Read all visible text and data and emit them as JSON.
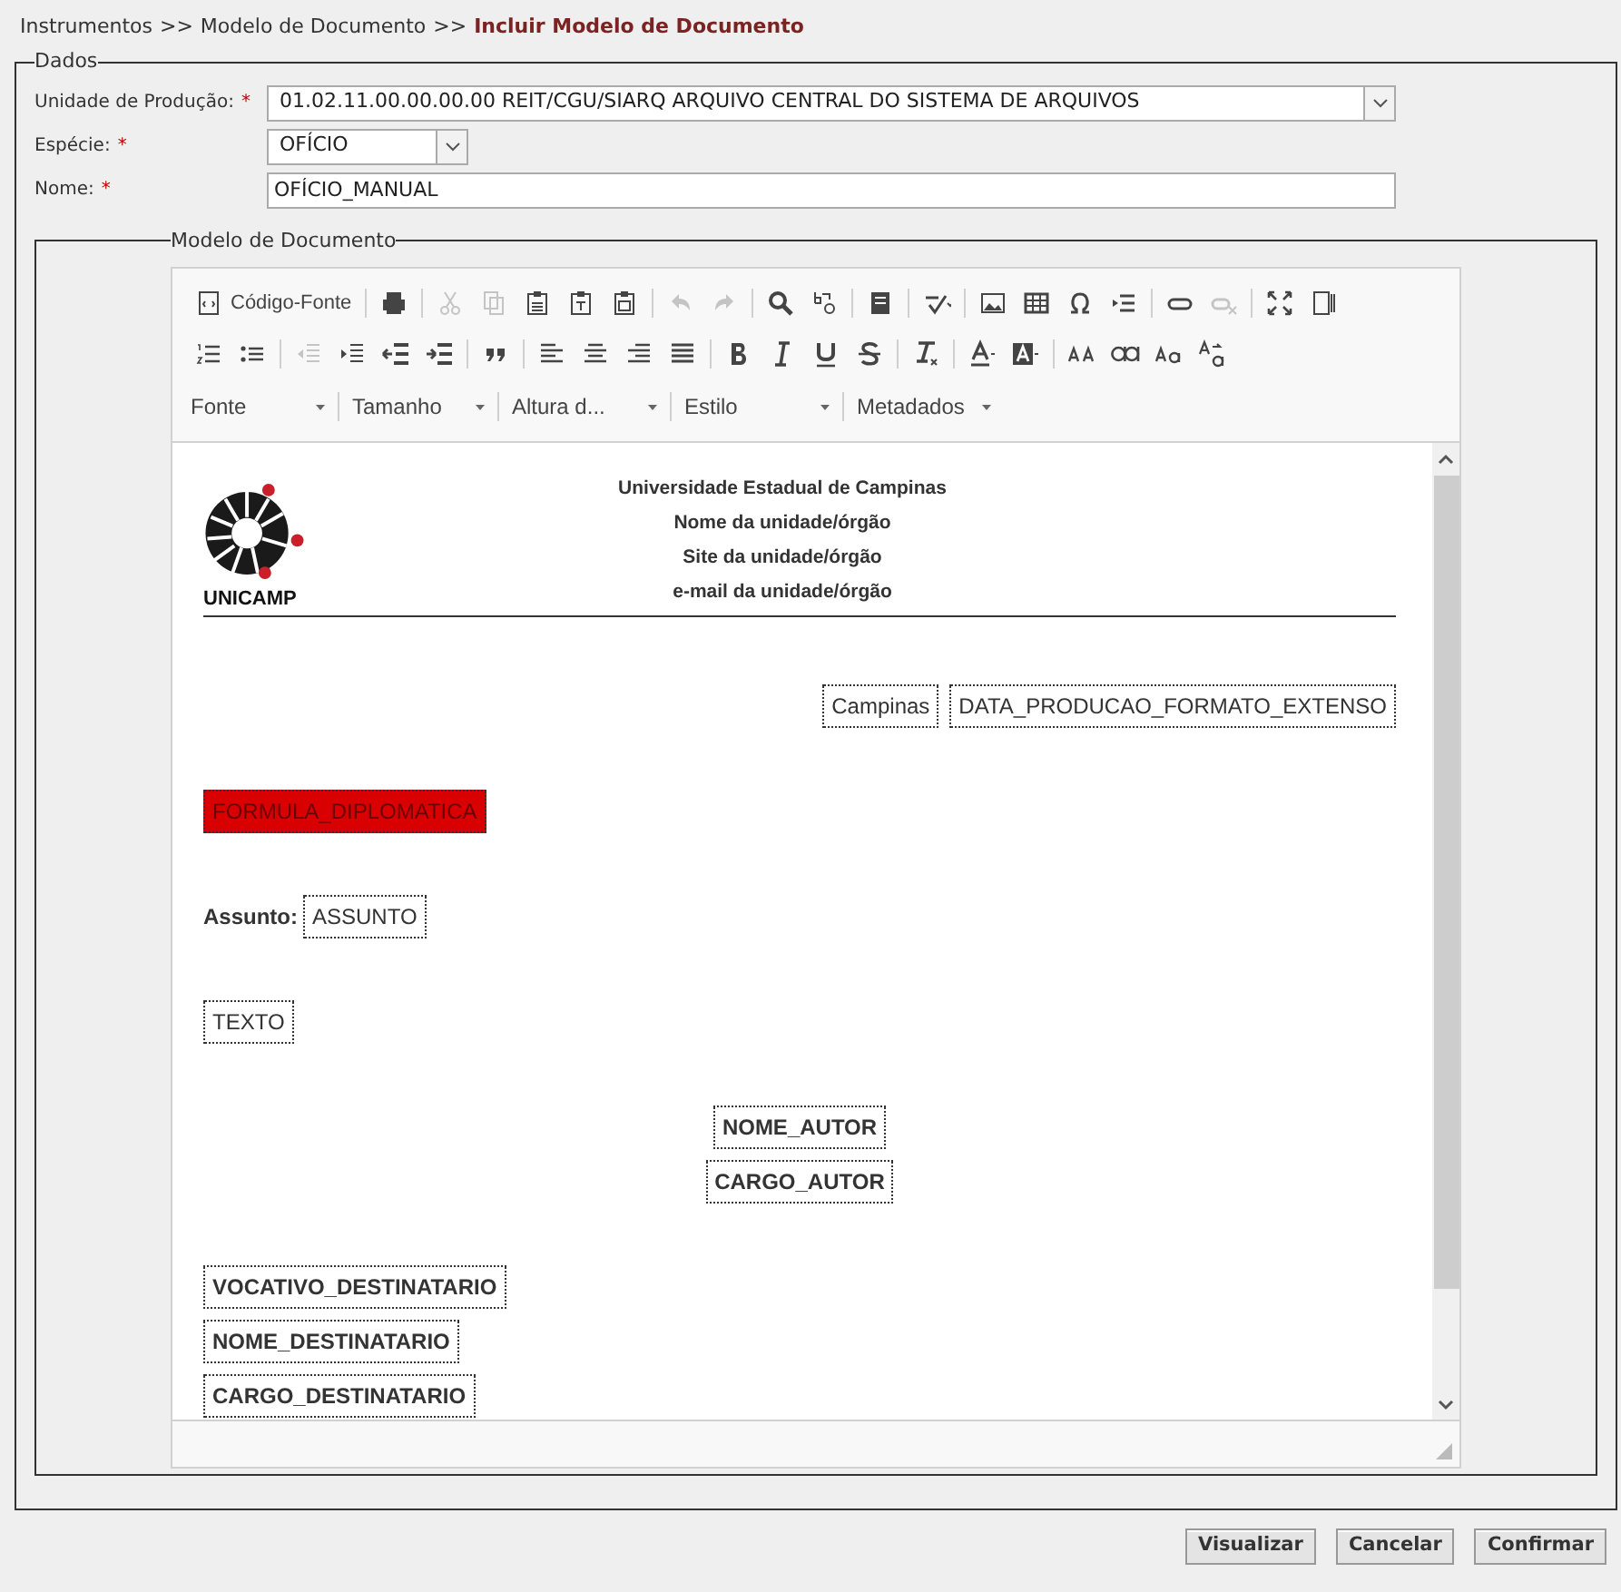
{
  "breadcrumb": [
    {
      "kind": "link",
      "text": "Instrumentos"
    },
    {
      "kind": "separator",
      "text": ">>"
    },
    {
      "kind": "link",
      "text": "Modelo de Documento"
    },
    {
      "kind": "separator",
      "text": ">>"
    },
    {
      "kind": "current",
      "text": "Incluir Modelo de Documento"
    }
  ],
  "dados": {
    "legend": "Dados",
    "fields": [
      {
        "kind": "select",
        "label": "Unidade de Produção:",
        "required": "*",
        "value": "01.02.11.00.00.00.00 REIT/CGU/SIARQ ARQUIVO CENTRAL DO SISTEMA DE ARQUIVOS"
      },
      {
        "kind": "choice",
        "label": "Espécie:",
        "required": "*",
        "value": "OFÍCIO"
      },
      {
        "kind": "input",
        "label": "Nome:",
        "required": "*",
        "value": "OFÍCIO_MANUAL"
      }
    ]
  },
  "modelo": {
    "legend": "Modelo de Documento",
    "toolbar": [
      [
        [
          {
            "kind": "source",
            "label": "Código-Fonte",
            "disabled": false
          }
        ],
        [
          {
            "kind": "print",
            "disabled": false
          }
        ],
        [
          {
            "kind": "cut",
            "disabled": true
          },
          {
            "kind": "copy",
            "disabled": true
          },
          {
            "kind": "paste",
            "disabled": false
          },
          {
            "kind": "pastetext",
            "disabled": false
          },
          {
            "kind": "pasteword",
            "disabled": false
          }
        ],
        [
          {
            "kind": "undo",
            "disabled": true
          },
          {
            "kind": "redo",
            "disabled": true
          }
        ],
        [
          {
            "kind": "find",
            "disabled": false
          },
          {
            "kind": "replace",
            "disabled": false
          }
        ],
        [
          {
            "kind": "template",
            "disabled": false
          }
        ],
        [
          {
            "kind": "spell",
            "disabled": false
          }
        ],
        [
          {
            "kind": "image",
            "disabled": false
          },
          {
            "kind": "table",
            "disabled": false
          },
          {
            "kind": "omega",
            "disabled": false
          },
          {
            "kind": "pagebreak",
            "disabled": false
          }
        ],
        [
          {
            "kind": "link",
            "disabled": false
          },
          {
            "kind": "unlink",
            "disabled": true
          }
        ],
        [
          {
            "kind": "maximize",
            "disabled": false
          },
          {
            "kind": "blocks",
            "disabled": false
          }
        ]
      ],
      [
        [
          {
            "kind": "numlist",
            "disabled": false
          },
          {
            "kind": "bullist",
            "disabled": false
          }
        ],
        [
          {
            "kind": "outdent",
            "disabled": true
          },
          {
            "kind": "indent",
            "disabled": false
          },
          {
            "kind": "outdentbold",
            "disabled": false
          },
          {
            "kind": "indentbold",
            "disabled": false
          }
        ],
        [
          {
            "kind": "quote",
            "disabled": false
          }
        ],
        [
          {
            "kind": "alignleft",
            "disabled": false
          },
          {
            "kind": "aligncenter",
            "disabled": false
          },
          {
            "kind": "alignright",
            "disabled": false
          },
          {
            "kind": "justify",
            "disabled": false
          }
        ],
        [
          {
            "kind": "bold",
            "disabled": false
          },
          {
            "kind": "italic",
            "disabled": false
          },
          {
            "kind": "underline",
            "disabled": false
          },
          {
            "kind": "strike",
            "disabled": false
          }
        ],
        [
          {
            "kind": "removeformat",
            "disabled": false
          }
        ],
        [
          {
            "kind": "textcolor",
            "disabled": false
          },
          {
            "kind": "bgcolor",
            "disabled": false
          }
        ],
        [
          {
            "kind": "upper",
            "disabled": false
          },
          {
            "kind": "lower",
            "disabled": false
          },
          {
            "kind": "capital",
            "disabled": false
          },
          {
            "kind": "toggle",
            "disabled": false
          }
        ]
      ]
    ],
    "dropdowns": [
      "Fonte",
      "Tamanho",
      "Altura d...",
      "Estilo",
      "Metadados"
    ],
    "header": {
      "logo_text": "UNICAMP",
      "lines": [
        "Universidade Estadual de Campinas",
        "Nome da unidade/órgão",
        "Site da unidade/órgão",
        "e-mail da unidade/órgão"
      ]
    },
    "blocks": [
      {
        "kind": "dateline",
        "items": [
          "Campinas",
          "DATA_PRODUCAO_FORMATO_EXTENSO"
        ]
      },
      {
        "kind": "salutation",
        "items": [
          "FORMULA_DIPLOMATICA"
        ]
      },
      {
        "kind": "subject",
        "label": "Assunto:",
        "items": [
          "ASSUNTO"
        ]
      },
      {
        "kind": "body",
        "items": [
          "TEXTO"
        ]
      },
      {
        "kind": "signature",
        "items": [
          "NOME_AUTOR",
          "CARGO_AUTOR"
        ]
      },
      {
        "kind": "recipient",
        "items": [
          "VOCATIVO_DESTINATARIO",
          "NOME_DESTINATARIO",
          "CARGO_DESTINATARIO"
        ]
      }
    ]
  },
  "buttons": [
    "Visualizar",
    "Cancelar",
    "Confirmar"
  ]
}
